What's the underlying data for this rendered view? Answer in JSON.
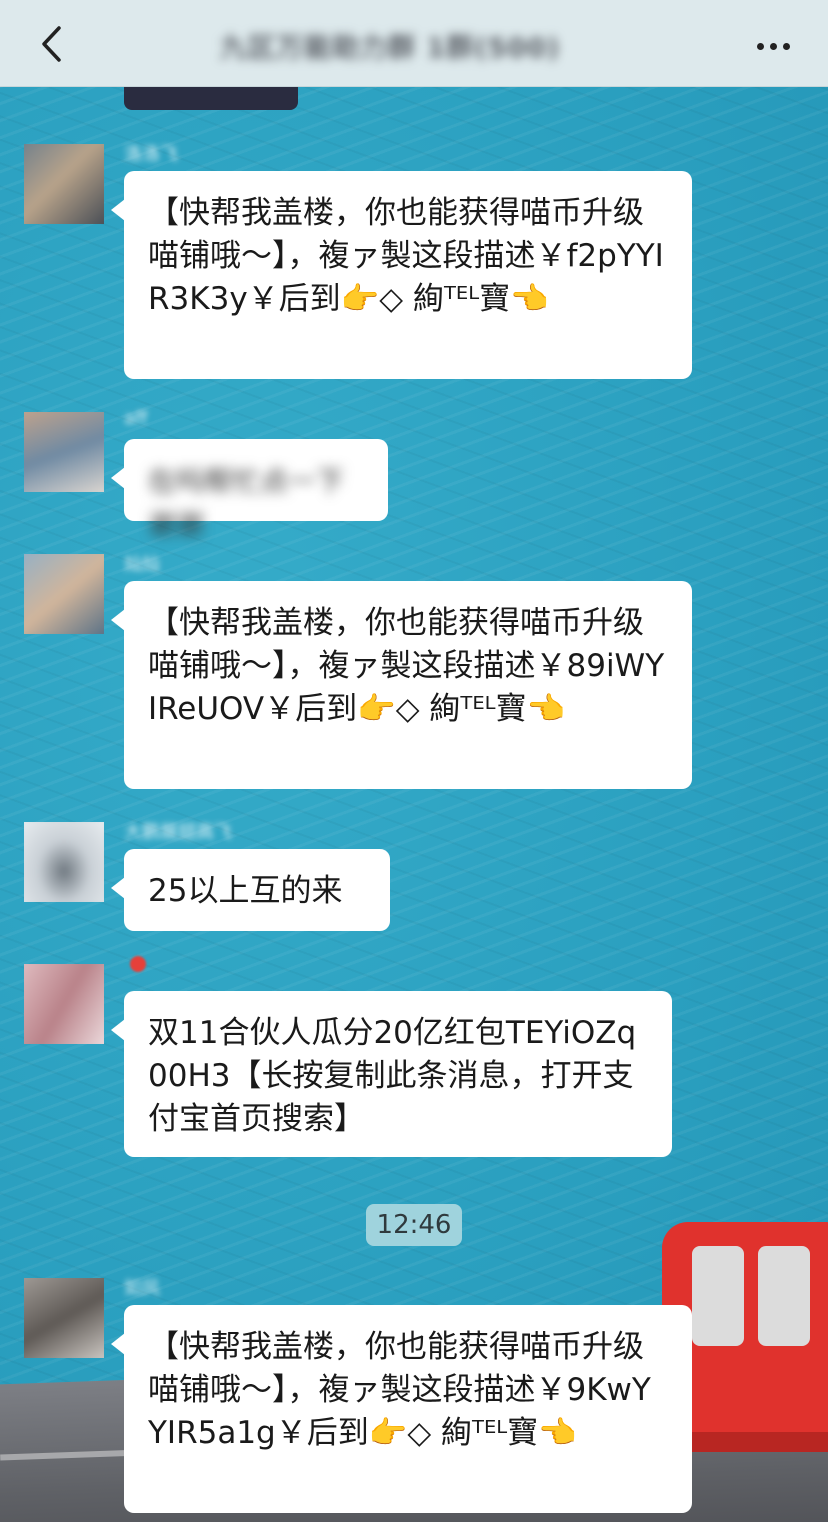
{
  "nav": {
    "back_icon": "chevron-left-icon",
    "title": "九区万能助力群 1群(500)",
    "more_icon": "ellipsis-icon"
  },
  "messages": [
    {
      "sender": "洛洛飞",
      "avatar_colors": [
        "#6b7d8c",
        "#b8a38a",
        "#3d4550"
      ],
      "text": "【快帮我盖楼，你也能获得喵币升级喵铺哦～】，複ァ製这段描述￥f2pYYIR3K3y￥后到👉◇ 絢ᵀᴱᴸ寶👈"
    },
    {
      "sender": "aff",
      "avatar_colors": [
        "#c8a58a",
        "#6f8aa3",
        "#e8dfd6"
      ],
      "text": "在吗帮忙点一下谢谢"
    },
    {
      "sender": "灿灿",
      "avatar_colors": [
        "#8fb0c9",
        "#d1b59b",
        "#4d6a84"
      ],
      "text": "【快帮我盖楼，你也能获得喵币升级喵铺哦～】，複ァ製这段描述￥89iWYIReUOV￥后到👉◇ 絢ᵀᴱᴸ寶👈"
    },
    {
      "sender": "大鹏展翅高飞",
      "avatar_colors": [
        "#eef2f5",
        "#9aa3ad",
        "#c9d0d6"
      ],
      "text": "25以上互的来"
    },
    {
      "sender": "",
      "avatar_colors": [
        "#e4c2c6",
        "#b98289",
        "#f2e4e6"
      ],
      "text": "双11合伙人瓜分20亿红包TEYiOZq00H3【长按复制此条消息，打开支付宝首页搜索】"
    },
    {
      "sender": "如风",
      "avatar_colors": [
        "#a7a29d",
        "#5e5955",
        "#d8d3ce"
      ],
      "text": "【快帮我盖楼，你也能获得喵币升级喵铺哦～】，複ァ製这段描述￥9KwYYIR5a1g￥后到👉◇ 絢ᵀᴱᴸ寶👈"
    }
  ],
  "timestamp": "12:46"
}
